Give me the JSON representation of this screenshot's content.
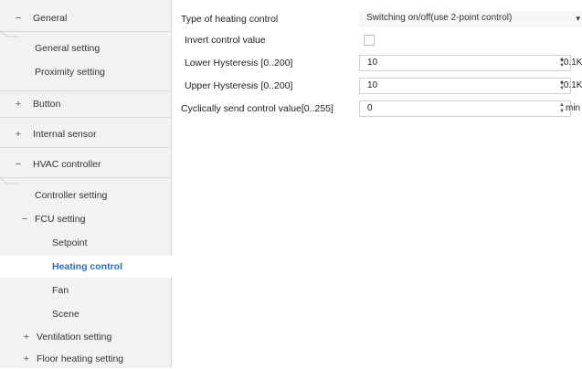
{
  "sidebar": {
    "general": {
      "toggle": "−",
      "label": "General",
      "items": [
        "General setting",
        "Proximity setting"
      ]
    },
    "button": {
      "toggle": "+",
      "label": "Button"
    },
    "internal_sensor": {
      "toggle": "+",
      "label": "Internal sensor"
    },
    "hvac": {
      "toggle": "−",
      "label": "HVAC controller",
      "controller_setting": "Controller setting",
      "fcu": {
        "toggle": "−",
        "label": "FCU setting",
        "items": [
          "Setpoint",
          "Heating control",
          "Fan",
          "Scene"
        ]
      },
      "ventilation": {
        "toggle": "+",
        "label": "Ventilation setting"
      },
      "floor_heating": {
        "toggle": "+",
        "label": "Floor heating setting"
      }
    }
  },
  "params": {
    "heating_type": {
      "label": "Type of heating control",
      "value": "Switching on/off(use 2-point control)",
      "arrow": "▾"
    },
    "invert": {
      "label": "Invert control value",
      "checked": false
    },
    "lower": {
      "label": "Lower Hysteresis [0..200]",
      "value": "10",
      "unit": "*0.1K"
    },
    "upper": {
      "label": "Upper Hysteresis [0..200]",
      "value": "10",
      "unit": "*0.1K"
    },
    "cyclic": {
      "label": "Cyclically send control value[0..255]",
      "value": "0",
      "unit": "min"
    }
  },
  "colors": {
    "active": "#2a6fb5",
    "sidebar_bg": "#f2f2f2"
  }
}
